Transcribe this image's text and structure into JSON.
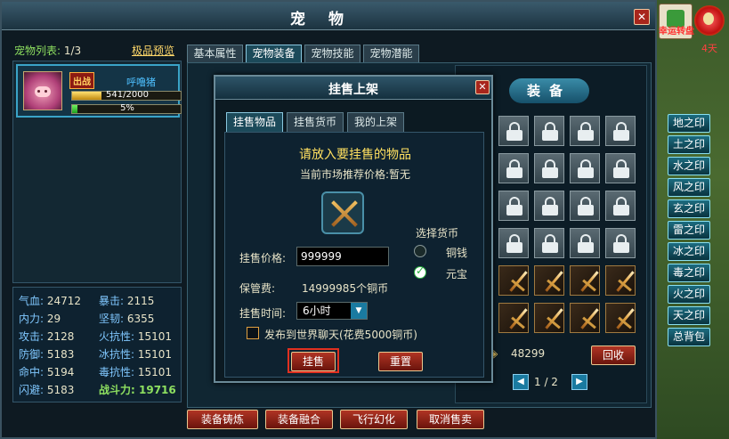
{
  "window": {
    "title": "宠物",
    "close_label": "✕"
  },
  "pet_list": {
    "label": "宠物列表:",
    "count": "1/3",
    "premium_link": "极品预览",
    "pet": {
      "badge": "出战",
      "name": "呼噜猪",
      "exp_text": "541/2000",
      "exp_fraction": 0.27,
      "growth_text": "5%",
      "growth_fraction": 0.05
    }
  },
  "stats": {
    "hp": {
      "label": "气血:",
      "value": "24712"
    },
    "crit": {
      "label": "暴击:",
      "value": "2115"
    },
    "inner": {
      "label": "内力:",
      "value": "29"
    },
    "toughness": {
      "label": "坚韧:",
      "value": "6355"
    },
    "attack": {
      "label": "攻击:",
      "value": "2128"
    },
    "fire_res": {
      "label": "火抗性:",
      "value": "15101"
    },
    "defense": {
      "label": "防御:",
      "value": "5183"
    },
    "ice_res": {
      "label": "冰抗性:",
      "value": "15101"
    },
    "hit": {
      "label": "命中:",
      "value": "5194"
    },
    "poison_res": {
      "label": "毒抗性:",
      "value": "15101"
    },
    "dodge": {
      "label": "闪避:",
      "value": "5183"
    },
    "power": {
      "label": "战斗力:",
      "value": "19716"
    }
  },
  "tabs": {
    "basic": "基本属性",
    "equip": "宠物装备",
    "skill": "宠物技能",
    "potential": "宠物潜能"
  },
  "equip": {
    "title": "装备",
    "currency_icon": "yuanbao-icon",
    "currency_value": "48299",
    "recycle_label": "回收",
    "page": "1 / 2",
    "prev": "◀",
    "next": "▶"
  },
  "bottom_buttons": {
    "forge": "装备铸炼",
    "fuse": "装备融合",
    "flight": "飞行幻化",
    "cancel_sale": "取消售卖"
  },
  "sell_dialog": {
    "title": "挂售上架",
    "close_label": "✕",
    "tabs": {
      "item": "挂售物品",
      "currency": "挂售货币",
      "mine": "我的上架"
    },
    "prompt": "请放入要挂售的物品",
    "market_price": "当前市场推荐价格:暂无",
    "price_label": "挂售价格:",
    "price_value": "999999",
    "fee_label": "保管费:",
    "fee_value": "14999985个铜币",
    "time_label": "挂售时间:",
    "time_value": "6小时",
    "broadcast_label": "发布到世界聊天(花费5000铜币)",
    "currency_title": "选择货币",
    "copper_label": "铜钱",
    "yuanbao_label": "元宝",
    "selected_currency": "元宝",
    "sell_button": "挂售",
    "reset_button": "重置"
  },
  "seals": [
    "地之印",
    "土之印",
    "水之印",
    "风之印",
    "玄之印",
    "雷之印",
    "冰之印",
    "毒之印",
    "火之印",
    "天之印",
    "总背包"
  ],
  "top_right": {
    "lucky_label": "幸运转盘",
    "days": "4天"
  },
  "colors": {
    "accent_blue": "#3aa4c8",
    "button_red": "#b03424",
    "gold_text": "#ffe060",
    "green_text": "#8ee060"
  }
}
